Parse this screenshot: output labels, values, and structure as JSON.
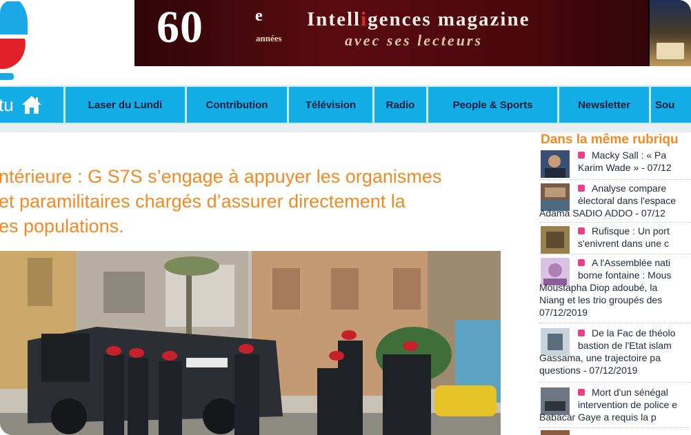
{
  "banner": {
    "big_number": "60",
    "superscript": "e",
    "annees": "années",
    "magazine_pre": "Intell",
    "magazine_hl": "i",
    "magazine_post": "gences magazine",
    "tagline": "avec ses lecteurs"
  },
  "nav": {
    "home_label": "tu",
    "items": [
      "Laser du Lundi",
      "Contribution",
      "Télévision",
      "Radio",
      "People & Sports",
      "Newsletter",
      "Sou"
    ]
  },
  "article": {
    "headline_lines": [
      "ntérieure : G S7S s’engage à appuyer les organismes",
      "et paramilitaires chargés d’assurer directement la",
      "es populations."
    ]
  },
  "sidebar": {
    "title": "Dans la même rubriqu",
    "items": [
      {
        "lines": [
          "Macky Sall : « Pa",
          "Karim Wade » - 07/12"
        ]
      },
      {
        "lines": [
          "Analyse compare",
          "électoral dans l'espace",
          "Adama SADIO ADDO - 07/12"
        ]
      },
      {
        "lines": [
          "Rufisque : Un port",
          "s'enivrent dans une c"
        ]
      },
      {
        "lines": [
          "A l'Assemblée nati",
          "borne fontaine : Mous",
          "Moustapha Diop adoubé, la",
          "Niang et les trio groupés des",
          "07/12/2019"
        ]
      },
      {
        "lines": [
          "De la Fac de théolo",
          "bastion de l'Etat islam",
          "Gassama, une trajectoire pa",
          "questions - 07/12/2019"
        ]
      },
      {
        "lines": [
          "Mort d'un sénégal",
          "intervention de police e",
          "Babacar Gaye a requis la p"
        ]
      }
    ]
  },
  "colors": {
    "nav_blue": "#13aee8",
    "headline_orange": "#f08a24",
    "bullet_pink": "#e83e8c",
    "banner_maroon": "#5a0b10"
  }
}
